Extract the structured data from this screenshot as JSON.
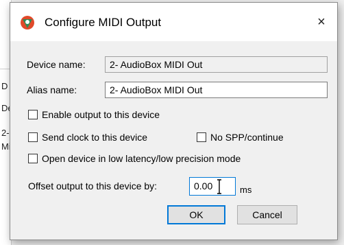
{
  "dialog": {
    "title": "Configure MIDI Output",
    "close_glyph": "×",
    "logo_icon": "reaper-logo-icon"
  },
  "device": {
    "device_name_label": "Device name:",
    "device_name_value": "2- AudioBox MIDI Out",
    "alias_name_label": "Alias name:",
    "alias_name_value": "2- AudioBox MIDI Out"
  },
  "options": {
    "enable_output": {
      "label": "Enable output to this device",
      "checked": false
    },
    "send_clock": {
      "label": "Send clock to this device",
      "checked": false
    },
    "no_spp": {
      "label": "No SPP/continue",
      "checked": false
    },
    "low_latency": {
      "label": "Open device in low latency/low precision mode",
      "checked": false
    }
  },
  "offset": {
    "label": "Offset output to this device by:",
    "value": "0.00",
    "unit": "ms"
  },
  "buttons": {
    "ok": "OK",
    "cancel": "Cancel"
  },
  "background": {
    "fragments": [
      "D",
      "De",
      "2-",
      "Mi"
    ]
  },
  "colors": {
    "accent": "#0078d7",
    "dialog_bg": "#f0f0f0",
    "logo_green": "#2e8b57",
    "logo_red": "#e04a2a"
  }
}
